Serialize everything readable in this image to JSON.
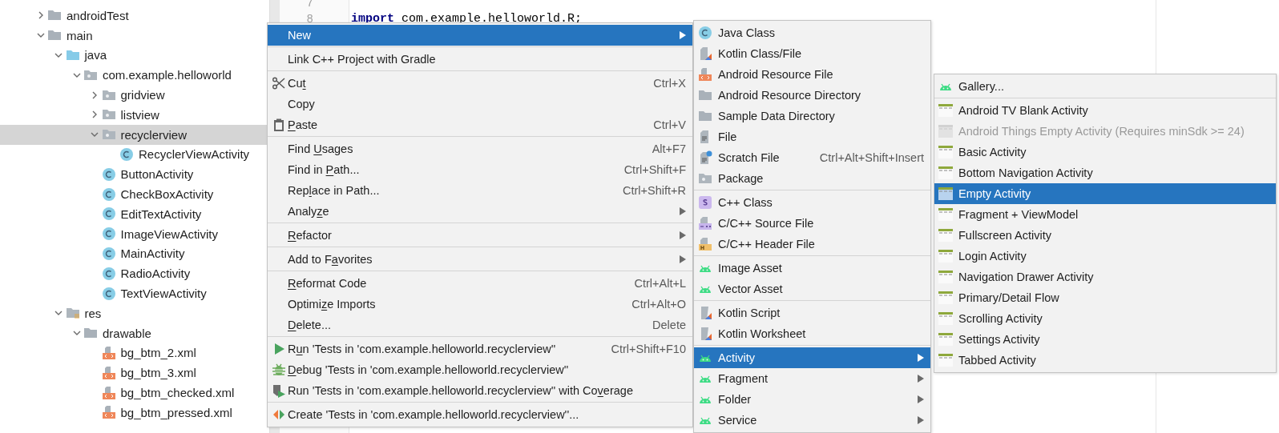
{
  "project_tree": {
    "items": [
      {
        "label": "androidTest",
        "kind": "folder",
        "expanded": false,
        "selected": false
      },
      {
        "label": "main",
        "kind": "folder",
        "expanded": true,
        "selected": false,
        "children": [
          {
            "label": "java",
            "kind": "source-folder",
            "expanded": true,
            "selected": false,
            "children": [
              {
                "label": "com.example.helloworld",
                "kind": "package",
                "expanded": true,
                "selected": false,
                "children": [
                  {
                    "label": "gridview",
                    "kind": "package",
                    "expanded": false,
                    "selected": false
                  },
                  {
                    "label": "listview",
                    "kind": "package",
                    "expanded": false,
                    "selected": false
                  },
                  {
                    "label": "recyclerview",
                    "kind": "package",
                    "expanded": true,
                    "selected": true,
                    "children": [
                      {
                        "label": "RecyclerViewActivity",
                        "kind": "class",
                        "selected": false
                      }
                    ]
                  },
                  {
                    "label": "ButtonActivity",
                    "kind": "class",
                    "selected": false
                  },
                  {
                    "label": "CheckBoxActivity",
                    "kind": "class",
                    "selected": false
                  },
                  {
                    "label": "EditTextActivity",
                    "kind": "class",
                    "selected": false
                  },
                  {
                    "label": "ImageViewActivity",
                    "kind": "class",
                    "selected": false
                  },
                  {
                    "label": "MainActivity",
                    "kind": "class",
                    "selected": false
                  },
                  {
                    "label": "RadioActivity",
                    "kind": "class",
                    "selected": false
                  },
                  {
                    "label": "TextViewActivity",
                    "kind": "class",
                    "selected": false
                  }
                ]
              }
            ]
          },
          {
            "label": "res",
            "kind": "res-folder",
            "expanded": true,
            "selected": false,
            "children": [
              {
                "label": "drawable",
                "kind": "folder",
                "expanded": true,
                "selected": false,
                "children": [
                  {
                    "label": "bg_btm_2.xml",
                    "kind": "xml-file",
                    "selected": false
                  },
                  {
                    "label": "bg_btm_3.xml",
                    "kind": "xml-file",
                    "selected": false
                  },
                  {
                    "label": "bg_btm_checked.xml",
                    "kind": "xml-file",
                    "selected": false
                  },
                  {
                    "label": "bg_btm_pressed.xml",
                    "kind": "xml-file",
                    "selected": false
                  }
                ]
              }
            ]
          }
        ]
      }
    ]
  },
  "editor": {
    "lines": [
      {
        "number": "7"
      },
      {
        "number": "8",
        "code": "**import** com.example.helloworld.R;"
      }
    ]
  },
  "context_menu": {
    "groups": [
      {
        "items": [
          {
            "label": "New",
            "selected": true,
            "submenu": true
          }
        ]
      },
      {
        "items": [
          {
            "label": "Link C++ Project with Gradle",
            "selected": false,
            "submenu": false
          }
        ]
      },
      {
        "items": [
          {
            "parts": [
              {
                "text": "Cu",
                "underlined": false
              },
              {
                "text": "t",
                "underlined": true
              }
            ],
            "kind": "scissors",
            "shortcut": "Ctrl+X",
            "selected": false,
            "submenu": false
          },
          {
            "label": "Copy",
            "selected": false,
            "submenu": false
          },
          {
            "parts": [
              {
                "text": "P",
                "underlined": true
              },
              {
                "text": "aste",
                "underlined": false
              }
            ],
            "kind": "clipboard",
            "shortcut": "Ctrl+V",
            "selected": false,
            "submenu": false
          }
        ]
      },
      {
        "items": [
          {
            "parts": [
              {
                "text": "Find ",
                "underlined": false
              },
              {
                "text": "U",
                "underlined": true
              },
              {
                "text": "sages",
                "underlined": false
              }
            ],
            "shortcut": "Alt+F7",
            "selected": false,
            "submenu": false
          },
          {
            "parts": [
              {
                "text": "Find in ",
                "underlined": false
              },
              {
                "text": "P",
                "underlined": true
              },
              {
                "text": "ath...",
                "underlined": false
              }
            ],
            "shortcut": "Ctrl+Shift+F",
            "selected": false,
            "submenu": false
          },
          {
            "parts": [
              {
                "text": "Rep",
                "underlined": false
              },
              {
                "text": "l",
                "underlined": true
              },
              {
                "text": "ace in Path...",
                "underlined": false
              }
            ],
            "shortcut": "Ctrl+Shift+R",
            "selected": false,
            "submenu": false
          },
          {
            "parts": [
              {
                "text": "Analy",
                "underlined": false
              },
              {
                "text": "z",
                "underlined": true
              },
              {
                "text": "e",
                "underlined": false
              }
            ],
            "selected": false,
            "submenu": true
          }
        ]
      },
      {
        "items": [
          {
            "parts": [
              {
                "text": "R",
                "underlined": true
              },
              {
                "text": "efactor",
                "underlined": false
              }
            ],
            "selected": false,
            "submenu": true
          }
        ]
      },
      {
        "items": [
          {
            "parts": [
              {
                "text": "Add to F",
                "underlined": false
              },
              {
                "text": "a",
                "underlined": true
              },
              {
                "text": "vorites",
                "underlined": false
              }
            ],
            "selected": false,
            "submenu": true
          }
        ]
      },
      {
        "items": [
          {
            "parts": [
              {
                "text": "R",
                "underlined": true
              },
              {
                "text": "eformat Code",
                "underlined": false
              }
            ],
            "shortcut": "Ctrl+Alt+L",
            "selected": false,
            "submenu": false
          },
          {
            "parts": [
              {
                "text": "Optimi",
                "underlined": false
              },
              {
                "text": "z",
                "underlined": true
              },
              {
                "text": "e Imports",
                "underlined": false
              }
            ],
            "shortcut": "Ctrl+Alt+O",
            "selected": false,
            "submenu": false
          },
          {
            "parts": [
              {
                "text": "D",
                "underlined": true
              },
              {
                "text": "elete...",
                "underlined": false
              }
            ],
            "shortcut": "Delete",
            "selected": false,
            "submenu": false
          }
        ]
      },
      {
        "items": [
          {
            "parts": [
              {
                "text": "R",
                "underlined": false
              },
              {
                "text": "u",
                "underlined": true
              },
              {
                "text": "n 'Tests in 'com.example.helloworld.recyclerview''",
                "underlined": false
              }
            ],
            "kind": "run",
            "shortcut": "Ctrl+Shift+F10",
            "selected": false,
            "submenu": false
          },
          {
            "parts": [
              {
                "text": "D",
                "underlined": true
              },
              {
                "text": "ebug 'Tests in 'com.example.helloworld.recyclerview''",
                "underlined": false
              }
            ],
            "kind": "debug",
            "selected": false,
            "submenu": false
          },
          {
            "parts": [
              {
                "text": "Run 'Tests in 'com.example.helloworld.recyclerview'' with Co",
                "underlined": false
              },
              {
                "text": "v",
                "underlined": true
              },
              {
                "text": "erage",
                "underlined": false
              }
            ],
            "kind": "coverage",
            "selected": false,
            "submenu": false
          }
        ]
      },
      {
        "items": [
          {
            "label": "Create 'Tests in 'com.example.helloworld.recyclerview''...",
            "kind": "create-test",
            "selected": false,
            "submenu": false
          }
        ]
      }
    ]
  },
  "new_submenu": {
    "groups": [
      {
        "items": [
          {
            "label": "Java Class",
            "kind": "class",
            "selected": false,
            "submenu": false
          },
          {
            "label": "Kotlin Class/File",
            "kind": "kotlin-file",
            "selected": false,
            "submenu": false
          },
          {
            "label": "Android Resource File",
            "kind": "xml-file",
            "selected": false,
            "submenu": false
          },
          {
            "label": "Android Resource Directory",
            "kind": "folder",
            "selected": false,
            "submenu": false
          },
          {
            "label": "Sample Data Directory",
            "kind": "folder",
            "selected": false,
            "submenu": false
          },
          {
            "label": "File",
            "kind": "text-file",
            "selected": false,
            "submenu": false
          },
          {
            "label": "Scratch File",
            "kind": "scratch-file",
            "shortcut": "Ctrl+Alt+Shift+Insert",
            "selected": false,
            "submenu": false
          },
          {
            "label": "Package",
            "kind": "package",
            "selected": false,
            "submenu": false
          }
        ]
      },
      {
        "items": [
          {
            "label": "C++ Class",
            "kind": "cpp-class",
            "selected": false,
            "submenu": false
          },
          {
            "label": "C/C++ Source File",
            "kind": "cpp-source",
            "selected": false,
            "submenu": false
          },
          {
            "label": "C/C++ Header File",
            "kind": "cpp-header",
            "selected": false,
            "submenu": false
          }
        ]
      },
      {
        "items": [
          {
            "label": "Image Asset",
            "kind": "android",
            "selected": false,
            "submenu": false
          },
          {
            "label": "Vector Asset",
            "kind": "android",
            "selected": false,
            "submenu": false
          }
        ]
      },
      {
        "items": [
          {
            "label": "Kotlin Script",
            "kind": "kotlin-script",
            "selected": false,
            "submenu": false
          },
          {
            "label": "Kotlin Worksheet",
            "kind": "kotlin-script",
            "selected": false,
            "submenu": false
          }
        ]
      },
      {
        "items": [
          {
            "label": "Activity",
            "kind": "android",
            "selected": true,
            "submenu": true
          },
          {
            "label": "Fragment",
            "kind": "android",
            "selected": false,
            "submenu": true
          },
          {
            "label": "Folder",
            "kind": "android",
            "selected": false,
            "submenu": true
          },
          {
            "label": "Service",
            "kind": "android",
            "selected": false,
            "submenu": true
          }
        ]
      }
    ]
  },
  "activity_submenu": {
    "groups": [
      {
        "items": [
          {
            "label": "Gallery...",
            "kind": "android",
            "selected": false,
            "disabled": false
          }
        ]
      },
      {
        "items": [
          {
            "label": "Android TV Blank Activity",
            "kind": "template",
            "selected": false,
            "disabled": false
          },
          {
            "label": "Android Things Empty Activity (Requires minSdk >= 24)",
            "kind": "template",
            "selected": false,
            "disabled": true
          },
          {
            "label": "Basic Activity",
            "kind": "template",
            "selected": false,
            "disabled": false
          },
          {
            "label": "Bottom Navigation Activity",
            "kind": "template",
            "selected": false,
            "disabled": false
          },
          {
            "label": "Empty Activity",
            "kind": "template",
            "selected": true,
            "disabled": false
          },
          {
            "label": "Fragment + ViewModel",
            "kind": "template",
            "selected": false,
            "disabled": false
          },
          {
            "label": "Fullscreen Activity",
            "kind": "template",
            "selected": false,
            "disabled": false
          },
          {
            "label": "Login Activity",
            "kind": "template",
            "selected": false,
            "disabled": false
          },
          {
            "label": "Navigation Drawer Activity",
            "kind": "template",
            "selected": false,
            "disabled": false
          },
          {
            "label": "Primary/Detail Flow",
            "kind": "template",
            "selected": false,
            "disabled": false
          },
          {
            "label": "Scrolling Activity",
            "kind": "template",
            "selected": false,
            "disabled": false
          },
          {
            "label": "Settings Activity",
            "kind": "template",
            "selected": false,
            "disabled": false
          },
          {
            "label": "Tabbed Activity",
            "kind": "template",
            "selected": false,
            "disabled": false
          }
        ]
      }
    ]
  }
}
